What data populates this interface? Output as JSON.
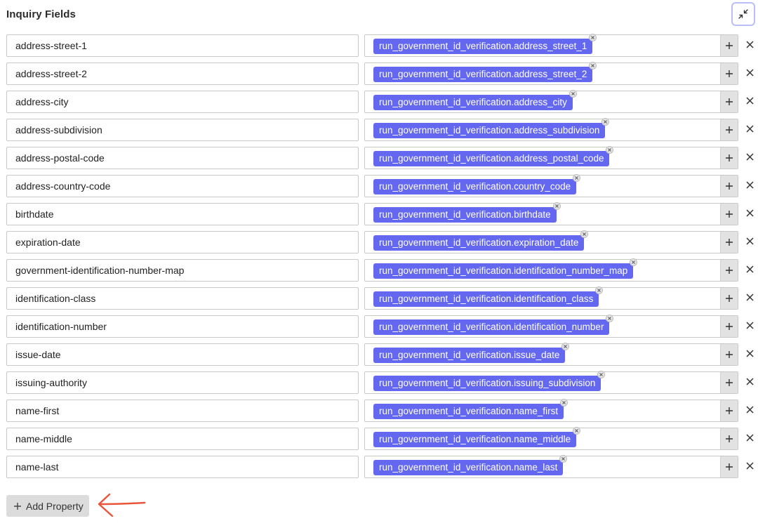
{
  "header": {
    "title": "Inquiry Fields"
  },
  "rows": [
    {
      "key": "address-street-1",
      "value": "run_government_id_verification.address_street_1"
    },
    {
      "key": "address-street-2",
      "value": "run_government_id_verification.address_street_2"
    },
    {
      "key": "address-city",
      "value": "run_government_id_verification.address_city"
    },
    {
      "key": "address-subdivision",
      "value": "run_government_id_verification.address_subdivision"
    },
    {
      "key": "address-postal-code",
      "value": "run_government_id_verification.address_postal_code"
    },
    {
      "key": "address-country-code",
      "value": "run_government_id_verification.country_code"
    },
    {
      "key": "birthdate",
      "value": "run_government_id_verification.birthdate"
    },
    {
      "key": "expiration-date",
      "value": "run_government_id_verification.expiration_date"
    },
    {
      "key": "government-identification-number-map",
      "value": "run_government_id_verification.identification_number_map"
    },
    {
      "key": "identification-class",
      "value": "run_government_id_verification.identification_class"
    },
    {
      "key": "identification-number",
      "value": "run_government_id_verification.identification_number"
    },
    {
      "key": "issue-date",
      "value": "run_government_id_verification.issue_date"
    },
    {
      "key": "issuing-authority",
      "value": "run_government_id_verification.issuing_subdivision"
    },
    {
      "key": "name-first",
      "value": "run_government_id_verification.name_first"
    },
    {
      "key": "name-middle",
      "value": "run_government_id_verification.name_middle"
    },
    {
      "key": "name-last",
      "value": "run_government_id_verification.name_last"
    }
  ],
  "footer": {
    "add_property_label": "Add Property"
  },
  "icons": {
    "collapse": "collapse-icon",
    "plus": "plus-icon",
    "close": "close-icon",
    "chip_remove": "chip-remove-icon",
    "annotation_arrow": "arrow-left-icon"
  },
  "colors": {
    "chip": "#6468f0",
    "annotation": "#e8553a",
    "collapse_border": "#b9bff5"
  }
}
